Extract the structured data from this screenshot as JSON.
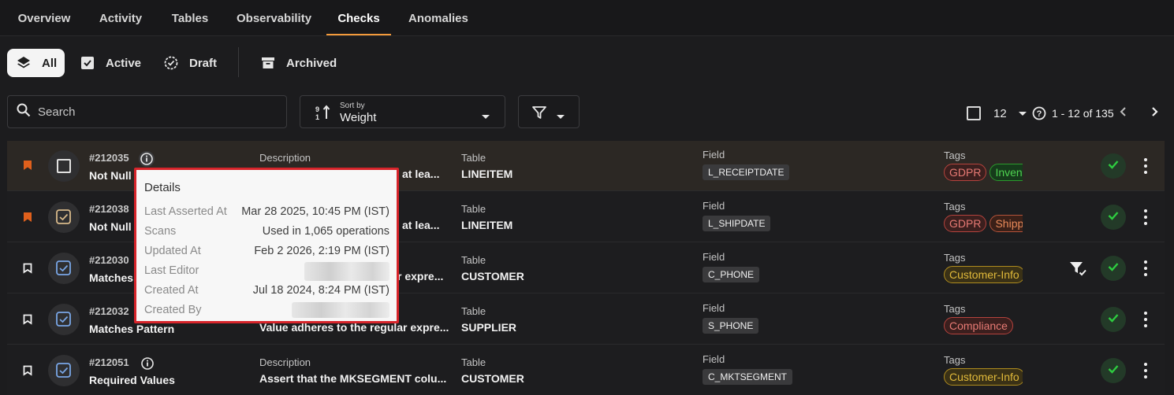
{
  "tabs": [
    "Overview",
    "Activity",
    "Tables",
    "Observability",
    "Checks",
    "Anomalies"
  ],
  "active_tab": "Checks",
  "status_filters": {
    "all": "All",
    "active": "Active",
    "draft": "Draft",
    "archived": "Archived"
  },
  "search": {
    "placeholder": "Search"
  },
  "sort": {
    "label": "Sort by",
    "value": "Weight"
  },
  "pagination": {
    "per_page": "12",
    "range": "1 - 12 of 135"
  },
  "columns": {
    "description": "Description",
    "table": "Table",
    "field": "Field",
    "tags": "Tags"
  },
  "rows": [
    {
      "id": "#212035",
      "name": "Not Null",
      "desc": "at lea...",
      "table": "LINEITEM",
      "field": "L_RECEIPTDATE",
      "tags": [
        "GDPR",
        "Inventory"
      ],
      "bookmark": "filled",
      "status_icon": "empty-checkbox-icon"
    },
    {
      "id": "#212038",
      "name": "Not Null",
      "desc": "at lea...",
      "table": "LINEITEM",
      "field": "L_SHIPDATE",
      "tags": [
        "GDPR",
        "Shipping"
      ],
      "bookmark": "filled",
      "status_icon": "draft-check-icon"
    },
    {
      "id": "#212030",
      "name": "Matches",
      "desc": "r expre...",
      "table": "CUSTOMER",
      "field": "C_PHONE",
      "tags": [
        "Customer-Info"
      ],
      "bookmark": "outline",
      "status_icon": "active-check-icon"
    },
    {
      "id": "#212032",
      "name": "Matches Pattern",
      "desc": "Value adheres to the regular expre...",
      "table": "SUPPLIER",
      "field": "S_PHONE",
      "tags": [
        "Compliance"
      ],
      "bookmark": "outline",
      "status_icon": "active-check-icon"
    },
    {
      "id": "#212051",
      "name": "Required Values",
      "desc": "Assert that the MKSEGMENT colu...",
      "table": "CUSTOMER",
      "field": "C_MKTSEGMENT",
      "tags": [
        "Customer-Info"
      ],
      "bookmark": "outline",
      "status_icon": "active-check-icon"
    }
  ],
  "popover": {
    "title": "Details",
    "items": [
      {
        "key": "Last Asserted At",
        "value": "Mar 28 2025, 10:45 PM (IST)"
      },
      {
        "key": "Scans",
        "value": "Used in 1,065 operations"
      },
      {
        "key": "Updated At",
        "value": "Feb 2 2026, 2:19 PM (IST)"
      },
      {
        "key": "Last Editor",
        "value": ""
      },
      {
        "key": "Created At",
        "value": "Jul 18 2024, 8:24 PM (IST)"
      },
      {
        "key": "Created By",
        "value": ""
      }
    ]
  },
  "colors": {
    "accent": "#f39a3b",
    "ok": "#2ecc40",
    "bookmark": "#e0601c",
    "popover_border": "#d7242a"
  }
}
